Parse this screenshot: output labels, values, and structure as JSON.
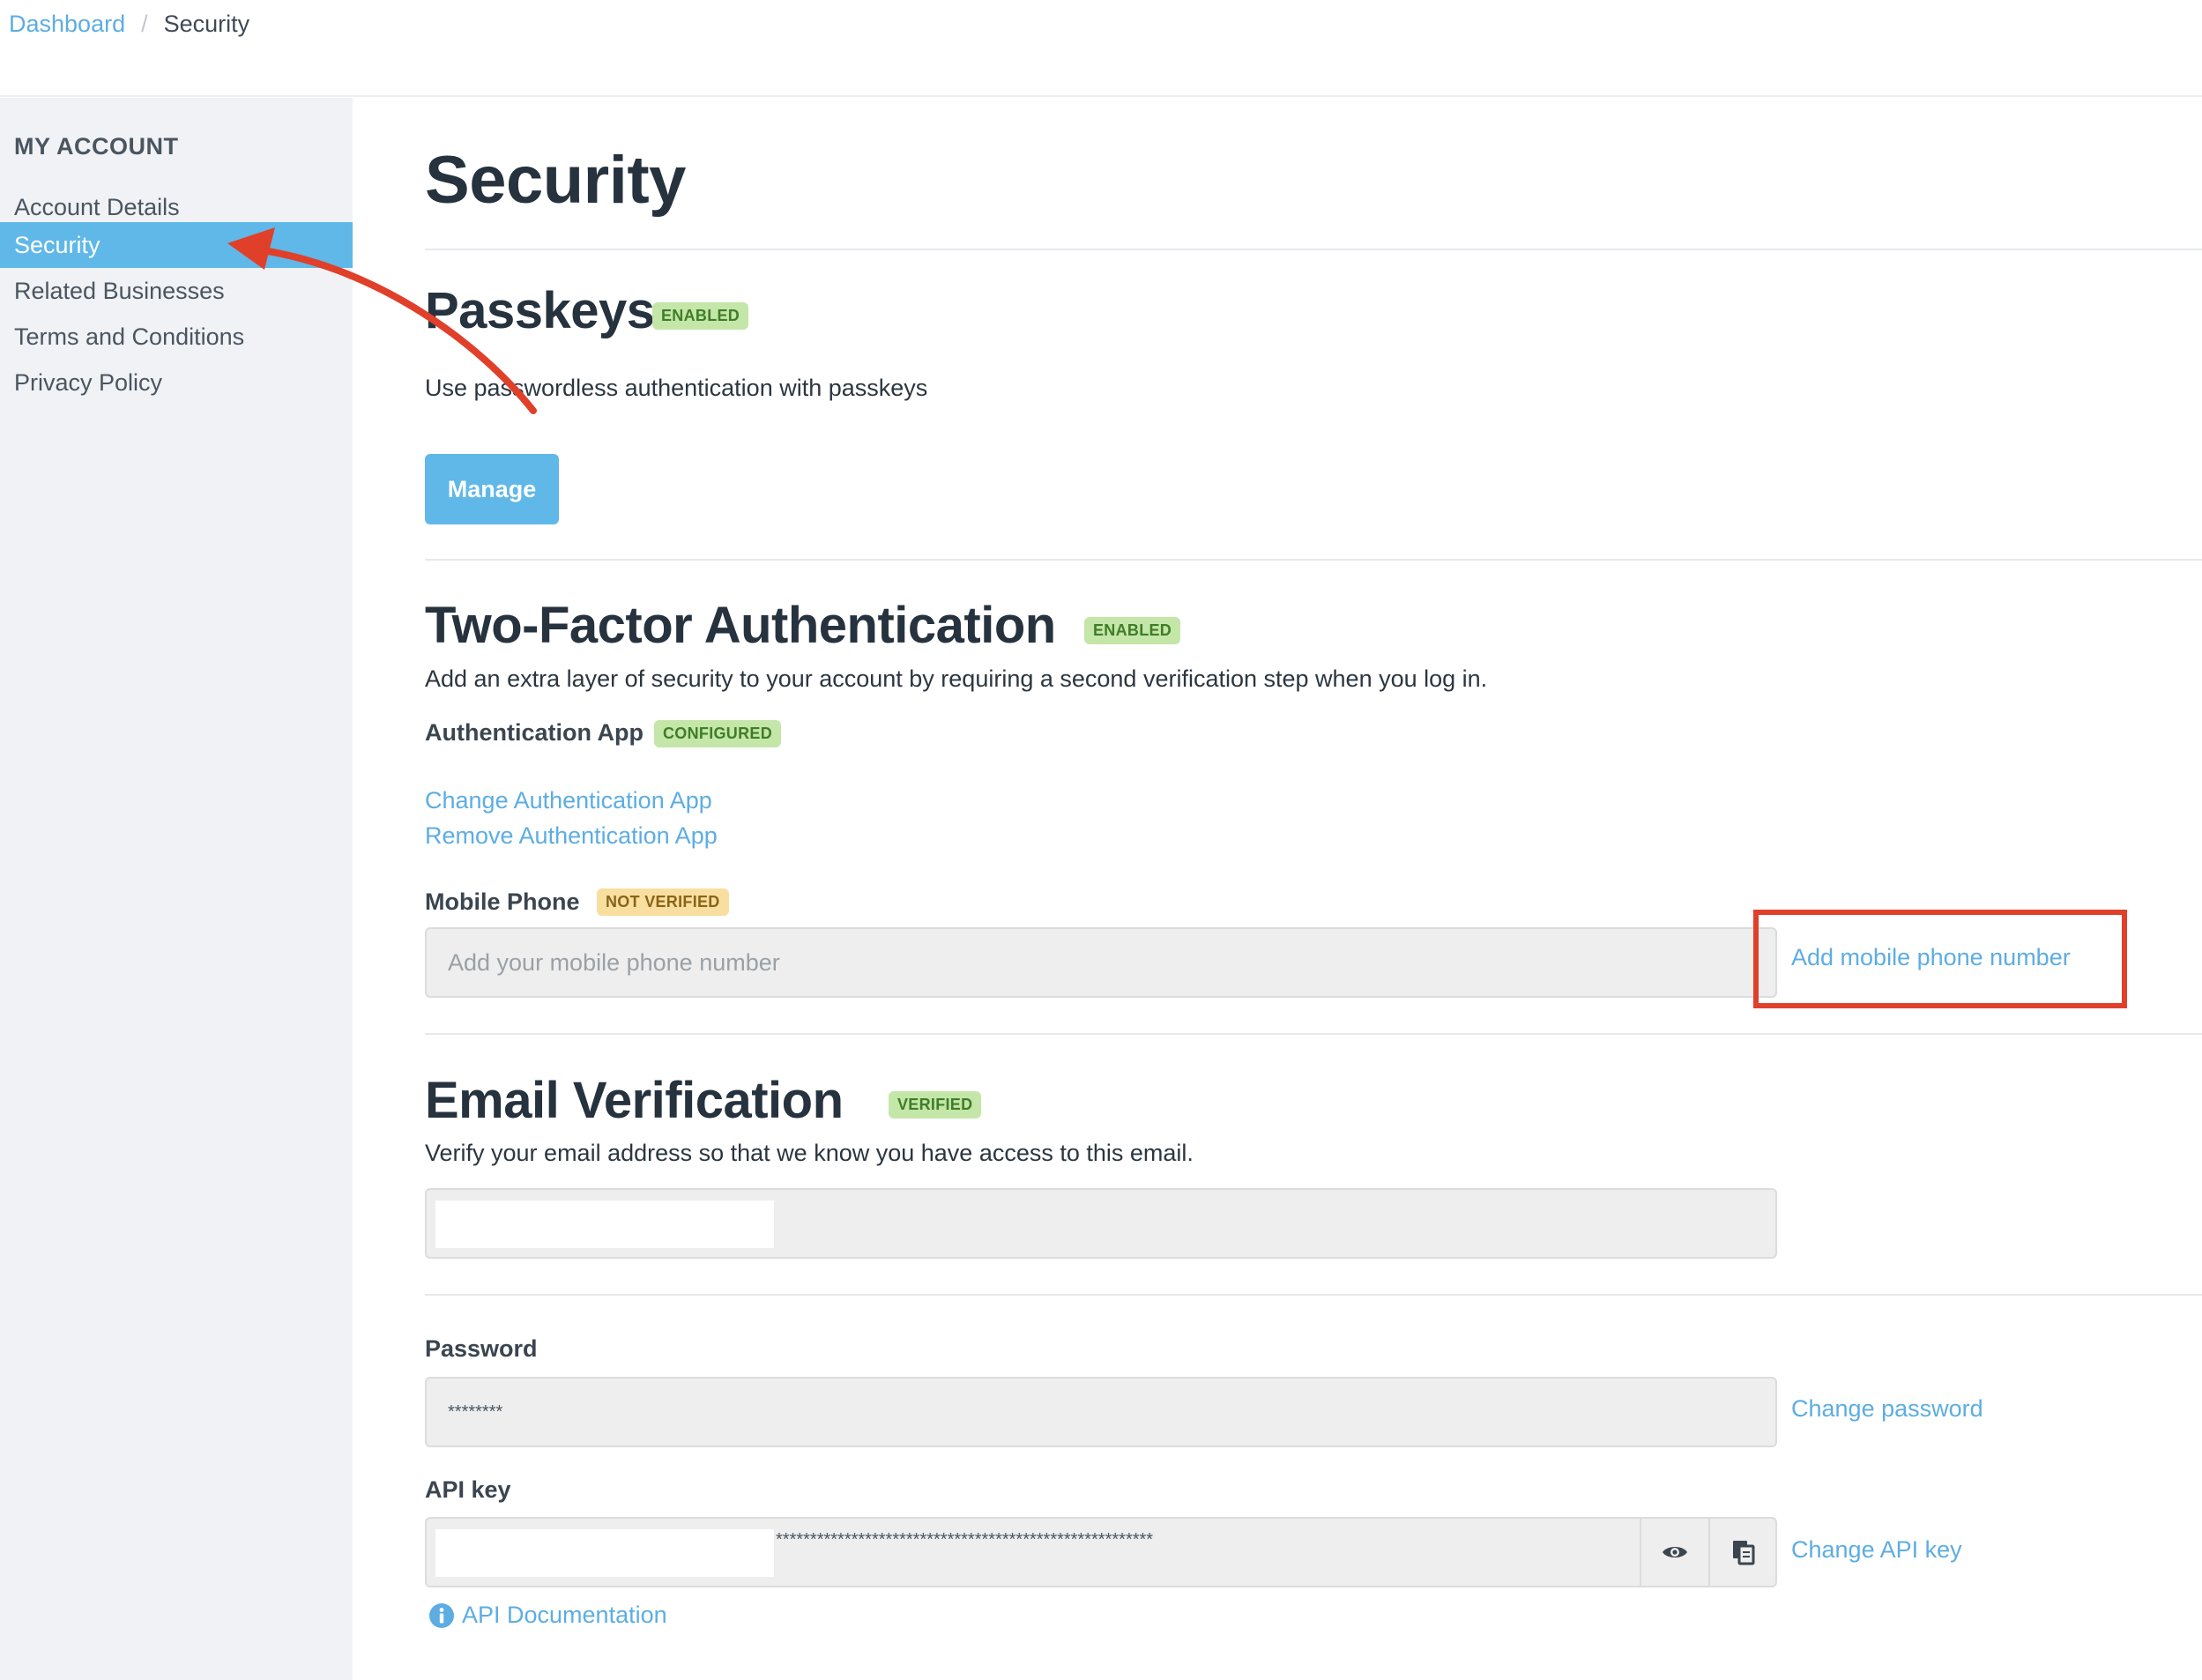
{
  "breadcrumb": {
    "root": "Dashboard",
    "separator": "/",
    "current": "Security"
  },
  "sidebar": {
    "heading": "MY ACCOUNT",
    "items": [
      {
        "label": "Account Details",
        "active": false
      },
      {
        "label": "Security",
        "active": true
      },
      {
        "label": "Related Businesses",
        "active": false
      },
      {
        "label": "Terms and Conditions",
        "active": false
      },
      {
        "label": "Privacy Policy",
        "active": false
      }
    ]
  },
  "page": {
    "title": "Security"
  },
  "passkeys": {
    "title": "Passkeys",
    "badge": "ENABLED",
    "description": "Use passwordless authentication with passkeys",
    "manage_label": "Manage"
  },
  "two_factor": {
    "title": "Two-Factor Authentication",
    "badge": "ENABLED",
    "description": "Add an extra layer of security to your account by requiring a second verification step when you log in.",
    "auth_app_label": "Authentication App",
    "auth_app_badge": "CONFIGURED",
    "change_app_link": "Change Authentication App",
    "remove_app_link": "Remove Authentication App",
    "mobile_label": "Mobile Phone",
    "mobile_badge": "NOT VERIFIED",
    "mobile_placeholder": "Add your mobile phone number",
    "add_mobile_link": "Add mobile phone number"
  },
  "email_verification": {
    "title": "Email Verification",
    "badge": "VERIFIED",
    "description": "Verify your email address so that we know you have access to this email."
  },
  "password": {
    "label": "Password",
    "value": "********",
    "change_link": "Change password"
  },
  "api_key": {
    "label": "API key",
    "masked_value": "*******************************************************",
    "change_link": "Change API key",
    "docs_link": "API Documentation"
  },
  "colors": {
    "accent": "#5fb8e8",
    "link": "#5dade2",
    "annotation": "#e0402a",
    "badge_green": "#c4e6a8",
    "badge_yellow": "#f8dfa0"
  }
}
